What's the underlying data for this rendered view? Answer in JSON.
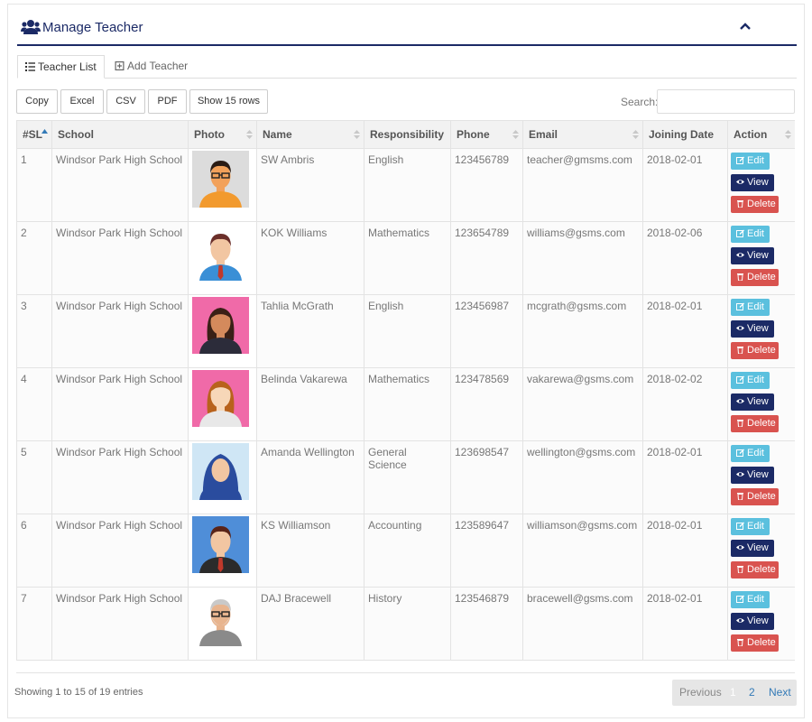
{
  "header": {
    "title": "Manage Teacher",
    "icon": "users-icon",
    "collapse_icon": "chevron-up-icon"
  },
  "tabs": [
    {
      "label": "Teacher List",
      "icon": "list-icon"
    },
    {
      "label": "Add Teacher",
      "icon": "plus-square-icon"
    }
  ],
  "toolbar": {
    "copy": "Copy",
    "excel": "Excel",
    "csv": "CSV",
    "pdf": "PDF",
    "show_rows": "Show 15 rows",
    "search_label": "Search:",
    "search_value": ""
  },
  "table": {
    "columns": [
      "#SL",
      "School",
      "Photo",
      "Name",
      "Responsibility",
      "Phone",
      "Email",
      "Joining Date",
      "Action"
    ],
    "rows": [
      {
        "sl": "1",
        "school": "Windsor Park High School",
        "photo": "male-teacher-glasses-avatar",
        "name": "SW Ambris",
        "responsibility": "English",
        "phone": "123456789",
        "email": "teacher@gmsms.com",
        "date": "2018-02-01"
      },
      {
        "sl": "2",
        "school": "Windsor Park High School",
        "photo": "male-teacher-blue-suit-avatar",
        "name": "KOK Williams",
        "responsibility": "Mathematics",
        "phone": "123654789",
        "email": "williams@gsms.com",
        "date": "2018-02-06"
      },
      {
        "sl": "3",
        "school": "Windsor Park High School",
        "photo": "female-teacher-dark-hair-avatar",
        "name": "Tahlia McGrath",
        "responsibility": "English",
        "phone": "123456987",
        "email": "mcgrath@gsms.com",
        "date": "2018-02-01"
      },
      {
        "sl": "4",
        "school": "Windsor Park High School",
        "photo": "female-teacher-auburn-hair-avatar",
        "name": "Belinda Vakarewa",
        "responsibility": "Mathematics",
        "phone": "123478569",
        "email": "vakarewa@gsms.com",
        "date": "2018-02-02"
      },
      {
        "sl": "5",
        "school": "Windsor Park High School",
        "photo": "female-teacher-hijab-avatar",
        "name": "Amanda Wellington",
        "responsibility": "General Science",
        "phone": "123698547",
        "email": "wellington@gsms.com",
        "date": "2018-02-01"
      },
      {
        "sl": "6",
        "school": "Windsor Park High School",
        "photo": "male-teacher-dark-suit-avatar",
        "name": "KS Williamson",
        "responsibility": "Accounting",
        "phone": "123589647",
        "email": "williamson@gsms.com",
        "date": "2018-02-01"
      },
      {
        "sl": "7",
        "school": "Windsor Park High School",
        "photo": "male-teacher-grey-beard-avatar",
        "name": "DAJ Bracewell",
        "responsibility": "History",
        "phone": "123546879",
        "email": "bracewell@gsms.com",
        "date": "2018-02-01"
      }
    ],
    "actions": {
      "edit": "Edit",
      "view": "View",
      "delete": "Delete"
    }
  },
  "footer": {
    "info": "Showing 1 to 15 of 19 entries",
    "previous": "Previous",
    "page1": "1",
    "page2": "2",
    "next": "Next"
  },
  "colors": {
    "navy": "#1b2a66",
    "edit": "#5bc0de",
    "delete": "#d9534f",
    "link": "#337ab7"
  }
}
